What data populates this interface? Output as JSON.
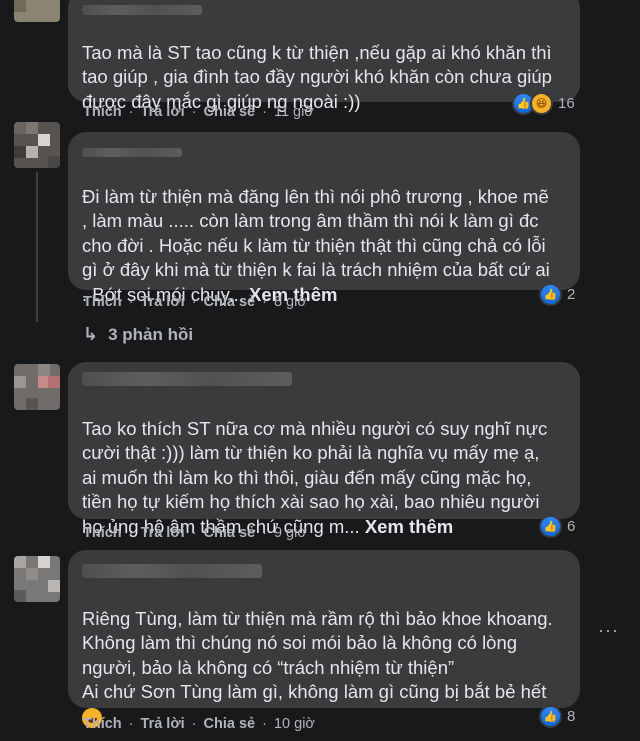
{
  "comments": [
    {
      "text": "Tao mà là ST tao cũng k từ thiện ,nếu gặp ai khó khăn thì\ntao giúp , gia đình tao đầy người khó khăn còn chưa giúp\nđược đây mắc gì giúp ng ngoài :))",
      "see_more": "",
      "actions": {
        "like": "Thích",
        "reply": "Trả lời",
        "share": "Chia sẻ",
        "time": "11 giờ"
      },
      "reactions": {
        "icons": [
          "like-icon",
          "haha-icon"
        ],
        "count": "16"
      }
    },
    {
      "text": "Đi làm từ thiện mà đăng lên thì nói phô trương , khoe mẽ\n, làm màu ..... còn làm trong âm thầm thì nói k làm gì đc\ncho đời . Hoặc nếu k làm từ thiện thật thì cũng chả có lỗi\ngì ở đây khi mà từ thiện k fai là trách nhiệm của bất cứ ai\n. Bớt soi mói chuy... ",
      "see_more": "Xem thêm",
      "actions": {
        "like": "Thích",
        "reply": "Trả lời",
        "share": "Chia sẻ",
        "time": "8 giờ"
      },
      "reactions": {
        "icons": [
          "like-icon"
        ],
        "count": "2"
      },
      "replies_label": "3 phản hồi"
    },
    {
      "text": "Tao ko thích ST nữa cơ mà nhiều người có suy nghĩ nực\ncười thật :))) làm từ thiện ko phải là nghĩa vụ mấy mẹ ạ,\nai muốn thì làm ko thì thôi, giàu đến mấy cũng mặc họ,\ntiền họ tự kiếm họ thích xài sao họ xài, bao nhiêu người\nhọ ủng hộ âm thầm chứ cũng m... ",
      "see_more": "Xem thêm",
      "actions": {
        "like": "Thích",
        "reply": "Trả lời",
        "share": "Chia sẻ",
        "time": "9 giờ"
      },
      "reactions": {
        "icons": [
          "like-icon"
        ],
        "count": "6"
      }
    },
    {
      "text": "Riêng Tùng, làm từ thiện mà rầm rộ thì bảo khoe khoang.\nKhông làm thì chúng nó soi mói bảo là không có lòng\nngười, bảo là không có “trách nhiệm từ thiện”\nAi chứ Sơn Tùng làm gì, không làm gì cũng bị bắt bẻ hết",
      "see_more": "",
      "actions": {
        "like": "Thích",
        "reply": "Trả lời",
        "share": "Chia sẻ",
        "time": "10 giờ"
      },
      "reactions": {
        "icons": [
          "like-icon"
        ],
        "count": "8"
      }
    }
  ],
  "colors": {
    "background": "#18191a",
    "bubble": "#3a3b3c",
    "text": "#e4e6eb",
    "secondary": "#b0b3b8",
    "like": "#2e89ff"
  }
}
